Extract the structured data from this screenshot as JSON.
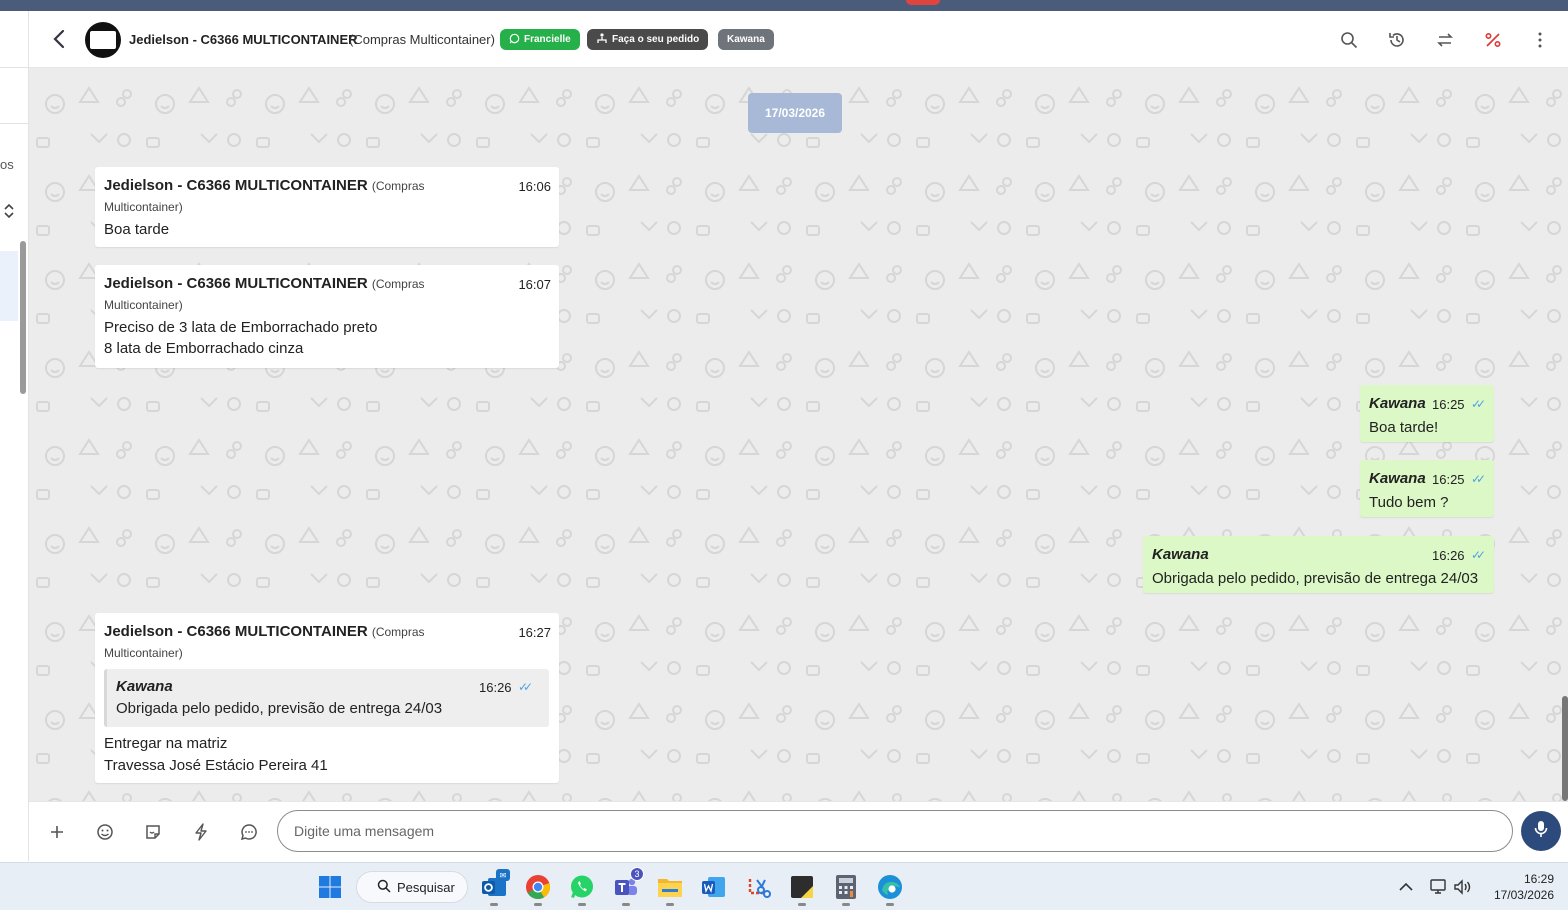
{
  "header": {
    "contact_name": "Jedielson - C6366 MULTICONTAINER",
    "contact_company": "(Compras Multicontainer)",
    "tags": {
      "whatsapp_tag": "Francielle",
      "funnel_tag": "Faça o seu pedido",
      "agent_tag": "Kawana"
    },
    "icons": [
      "search-icon",
      "history-icon",
      "transfer-icon",
      "percent-icon",
      "more-vertical-icon"
    ]
  },
  "left_panel": {
    "fragment_text": "os"
  },
  "chat": {
    "date_chip": "17/03/2026",
    "incoming": [
      {
        "sender": "Jedielson - C6366 MULTICONTAINER",
        "sender_company_1": "(Compras",
        "sender_company_2": "Multicontainer)",
        "time": "16:06",
        "lines": [
          "Boa tarde"
        ]
      },
      {
        "sender": "Jedielson - C6366 MULTICONTAINER",
        "sender_company_1": "(Compras",
        "sender_company_2": "Multicontainer)",
        "time": "16:07",
        "lines": [
          "Preciso de 3 lata de Emborrachado preto",
          "8 lata de Emborrachado cinza"
        ]
      },
      {
        "sender": "Jedielson - C6366 MULTICONTAINER",
        "sender_company_1": "(Compras",
        "sender_company_2": "Multicontainer)",
        "time": "16:27",
        "quote": {
          "sender": "Kawana",
          "time": "16:26",
          "text": "Obrigada pelo pedido, previsão de entrega 24/03"
        },
        "lines": [
          "Entregar na matriz",
          "Travessa José Estácio Pereira 41"
        ]
      }
    ],
    "outgoing": [
      {
        "sender": "Kawana",
        "time": "16:25",
        "text": "Boa tarde!"
      },
      {
        "sender": "Kawana",
        "time": "16:25",
        "text": "Tudo bem ?"
      },
      {
        "sender": "Kawana",
        "time": "16:26",
        "text": "Obrigada pelo pedido, previsão de entrega 24/03"
      }
    ],
    "check_glyph": "✓✓"
  },
  "composer": {
    "placeholder": "Digite uma mensagem",
    "icons": [
      "plus-icon",
      "emoji-icon",
      "sticker-icon",
      "lightning-icon",
      "chat-bubble-icon",
      "microphone-icon"
    ]
  },
  "taskbar": {
    "search_label": "Pesquisar",
    "teams_badge": "3",
    "outlook_badge": "✉",
    "apps": [
      "windows-start-icon",
      "outlook-icon",
      "chrome-icon",
      "whatsapp-icon",
      "teams-icon",
      "file-explorer-icon",
      "word-icon",
      "snipping-tool-icon",
      "sticky-notes-icon",
      "calculator-icon",
      "edge-icon"
    ],
    "clock_time": "16:29",
    "clock_date": "17/03/2026",
    "tray_chevron": "^"
  },
  "colors": {
    "outgoing_bubble": "#dcf8c6",
    "incoming_bubble": "#ffffff",
    "whatsapp_tag": "#25b04a",
    "date_chip": "#a7b9d6",
    "mic_button": "#2c4a7c",
    "check": "#4fa3e0"
  }
}
